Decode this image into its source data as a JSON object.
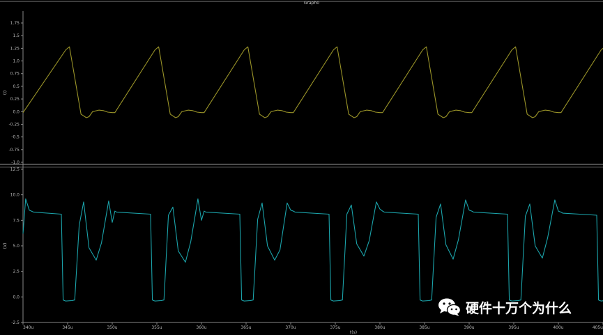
{
  "chart_data": [
    {
      "type": "line",
      "title": "Graph0",
      "ylabel": "(I)",
      "xlabel": "",
      "ylim": [
        -1.0,
        1.75
      ],
      "yticks": [
        "-1.0",
        "-0.75",
        "-0.5",
        "-0.25",
        "0.0",
        "0.25",
        "0.5",
        "0.75",
        "1.0",
        "1.25",
        "1.5",
        "1.75"
      ],
      "grid": false,
      "series": [
        {
          "color": "#9a9428",
          "x": [
            340.0,
            344.8,
            345.2,
            346.5,
            347.1,
            347.4,
            347.8,
            348.5,
            349.0,
            349.5,
            350.0,
            350.3,
            354.8,
            355.2,
            356.5,
            357.1,
            357.4,
            357.8,
            358.5,
            359.0,
            359.5,
            360.0,
            360.3,
            364.8,
            365.2,
            366.5,
            367.1,
            367.4,
            367.8,
            368.5,
            369.0,
            369.5,
            370.0,
            370.3,
            374.8,
            375.2,
            376.5,
            377.1,
            377.4,
            377.8,
            378.5,
            379.0,
            379.5,
            380.0,
            380.3,
            384.8,
            385.2,
            386.5,
            387.1,
            387.4,
            387.8,
            388.5,
            389.0,
            389.5,
            390.0,
            390.3,
            394.8,
            395.2,
            396.5,
            397.1,
            397.4,
            397.8,
            398.5,
            399.0,
            399.5,
            400.0,
            400.3,
            404.8,
            405.2
          ],
          "y": [
            -0.02,
            1.22,
            1.28,
            -0.05,
            -0.12,
            -0.1,
            0.0,
            0.03,
            0.02,
            -0.01,
            -0.02,
            -0.02,
            1.22,
            1.28,
            -0.05,
            -0.12,
            -0.1,
            0.0,
            0.03,
            0.02,
            -0.01,
            -0.02,
            -0.02,
            1.22,
            1.28,
            -0.05,
            -0.12,
            -0.1,
            0.0,
            0.03,
            0.02,
            -0.01,
            -0.02,
            -0.02,
            1.22,
            1.28,
            -0.05,
            -0.12,
            -0.1,
            0.0,
            0.03,
            0.02,
            -0.01,
            -0.02,
            -0.02,
            1.22,
            1.28,
            -0.05,
            -0.12,
            -0.1,
            0.0,
            0.03,
            0.02,
            -0.01,
            -0.02,
            -0.02,
            1.22,
            1.28,
            -0.05,
            -0.12,
            -0.1,
            0.0,
            0.03,
            0.02,
            -0.01,
            -0.02,
            -0.02,
            1.22,
            1.28
          ]
        }
      ]
    },
    {
      "type": "line",
      "title": "",
      "ylabel": "(V)",
      "xlabel": "t(s)",
      "ylim": [
        -2.5,
        12.5
      ],
      "yticks": [
        "-2.5",
        "0.0",
        "2.5",
        "5.0",
        "7.5",
        "10.0",
        "12.5"
      ],
      "xlim": [
        340,
        405
      ],
      "xticks": [
        "340u",
        "345u",
        "350u",
        "355u",
        "360u",
        "365u",
        "370u",
        "375u",
        "380u",
        "385u",
        "390u",
        "395u",
        "400u",
        "405u"
      ],
      "grid": false,
      "series": [
        {
          "color": "#1ba3aa",
          "x": [
            340.0,
            340.3,
            340.7,
            341.2,
            344.3,
            344.5,
            344.8,
            345.5,
            345.8,
            346.3,
            346.8,
            347.4,
            348.2,
            348.8,
            349.6,
            350.0,
            350.3,
            350.5,
            354.3,
            354.5,
            354.8,
            355.5,
            355.8,
            356.3,
            356.8,
            357.4,
            358.2,
            358.8,
            359.6,
            360.0,
            360.3,
            360.5,
            364.3,
            364.5,
            364.8,
            365.5,
            365.8,
            366.3,
            366.8,
            367.4,
            368.2,
            368.8,
            369.6,
            370.0,
            370.3,
            370.5,
            374.3,
            374.5,
            374.8,
            375.5,
            375.8,
            376.3,
            376.8,
            377.4,
            378.2,
            378.8,
            379.6,
            380.0,
            380.3,
            380.5,
            384.3,
            384.5,
            384.8,
            385.5,
            385.8,
            386.3,
            386.8,
            387.4,
            388.2,
            388.8,
            389.6,
            390.0,
            390.3,
            390.5,
            394.3,
            394.5,
            394.8,
            395.5,
            395.8,
            396.3,
            396.8,
            397.4,
            398.2,
            398.8,
            399.6,
            400.0,
            400.3,
            400.5,
            404.3,
            404.5,
            404.8,
            405.2
          ],
          "y": [
            6.2,
            9.6,
            8.5,
            8.3,
            8.1,
            -0.3,
            -0.4,
            -0.35,
            -0.3,
            7.0,
            9.3,
            4.8,
            3.6,
            5.3,
            9.4,
            7.3,
            8.4,
            8.3,
            8.1,
            -0.3,
            -0.4,
            -0.35,
            -0.3,
            8.0,
            8.8,
            4.5,
            3.4,
            5.4,
            9.6,
            7.5,
            8.4,
            8.3,
            8.1,
            -0.3,
            -0.4,
            -0.35,
            -0.3,
            7.6,
            9.2,
            5.0,
            3.6,
            4.6,
            9.2,
            8.5,
            8.4,
            8.3,
            8.1,
            -0.3,
            -0.4,
            -0.35,
            -0.3,
            8.1,
            9.0,
            5.2,
            4.0,
            5.5,
            9.3,
            8.6,
            8.4,
            8.3,
            8.1,
            -0.3,
            -0.4,
            -0.35,
            -0.3,
            7.8,
            9.1,
            5.1,
            3.7,
            5.6,
            9.5,
            8.5,
            8.4,
            8.3,
            8.1,
            -0.3,
            -0.4,
            -0.35,
            -0.3,
            7.9,
            9.1,
            5.0,
            3.8,
            5.8,
            9.5,
            8.4,
            8.3,
            8.2,
            8.0,
            -0.3,
            -0.4,
            -0.35
          ]
        }
      ]
    }
  ],
  "watermark": {
    "text": "硬件十万个为什么",
    "icon": "wechat-icon"
  }
}
